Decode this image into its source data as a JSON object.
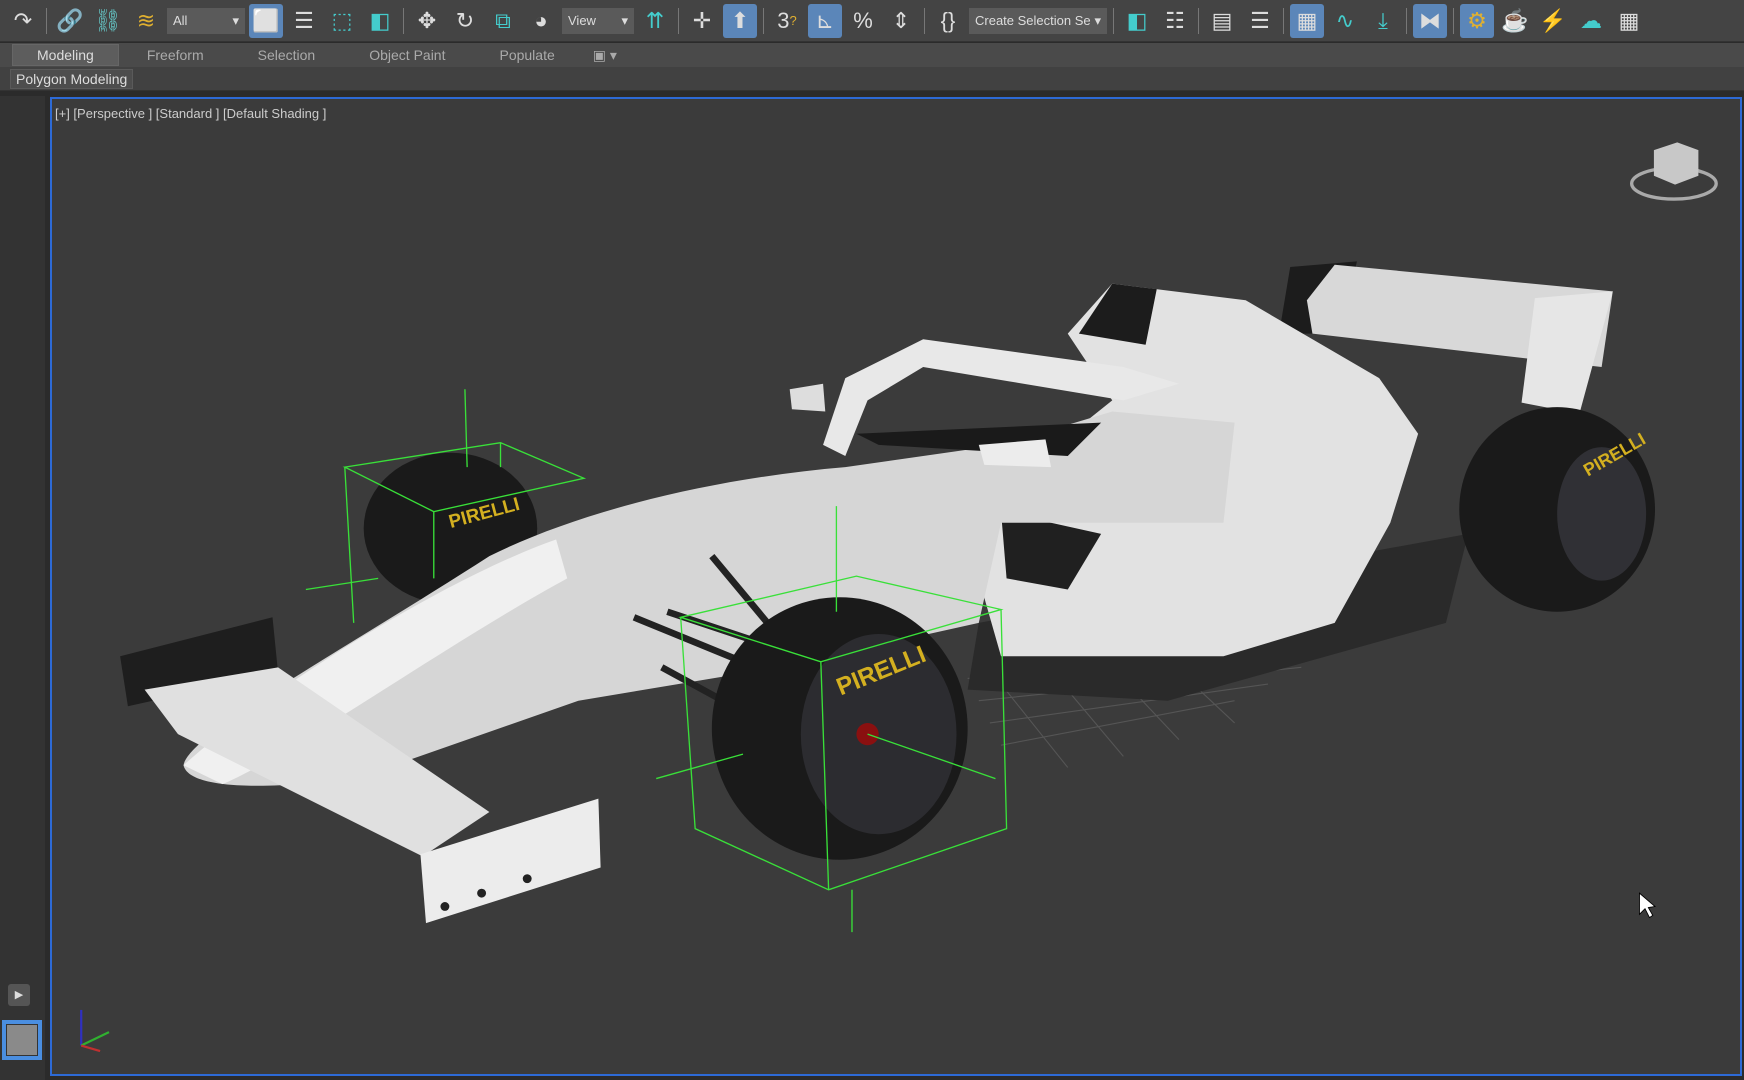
{
  "toolbar": {
    "items": [
      "redo-icon",
      "link-icon",
      "unlink-icon",
      "bind-spacewarp-icon",
      "selection-filter",
      "select-object-icon",
      "select-by-name-icon",
      "rectangle-selection-icon",
      "window-crossing-icon",
      "move-icon",
      "rotate-icon",
      "scale-icon",
      "place-icon",
      "reference-coordinate",
      "pivot-icon",
      "manipulate-icon",
      "keyboard-shortcut-icon",
      "snap-3d-icon",
      "angle-snap-icon",
      "percent-snap-icon",
      "spinner-snap-icon",
      "edit-named-selection-icon",
      "named-selection",
      "mirror-icon",
      "align-icon",
      "scene-explorer-icon",
      "layer-explorer-icon",
      "toggle-ribbon-icon",
      "curve-editor-icon",
      "dope-sheet-icon",
      "schematic-view-icon",
      "material-editor-icon",
      "render-setup-icon",
      "render-frame-icon",
      "render-icon",
      "render-cloud-icon",
      "rendered-viewports-icon"
    ],
    "selection_filter": "All",
    "reference_coordinate": "View",
    "named_selection": "Create Selection Se"
  },
  "ribbon": {
    "tabs": [
      "Modeling",
      "Freeform",
      "Selection",
      "Object Paint",
      "Populate"
    ],
    "active": "Modeling",
    "sub_label": "Polygon Modeling"
  },
  "viewport": {
    "label": "[+] [Perspective ] [Standard ] [Default Shading ]",
    "tire_text": "PIRELLI",
    "accent": "#2d6ad6",
    "gizmo_color": "#39e039"
  }
}
